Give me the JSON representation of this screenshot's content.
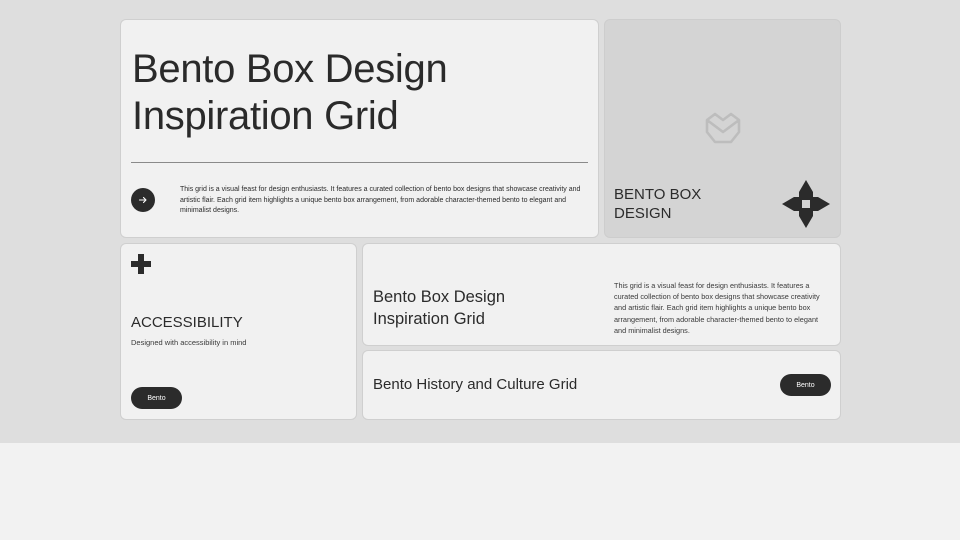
{
  "hero": {
    "title_line1": "Bento Box Design",
    "title_line2": "Inspiration Grid",
    "description": "This grid is a visual feast for design enthusiasts. It features a curated collection of bento box designs that showcase creativity and artistic flair. Each grid item highlights a unique bento box arrangement, from adorable character-themed bento to elegant and minimalist designs.",
    "arrow_icon": "arrow-right-icon"
  },
  "logo_card": {
    "title_line1": "BENTO BOX",
    "title_line2": "DESIGN",
    "logo_icon": "bento-logo-icon",
    "star_icon": "eight-point-star-icon"
  },
  "accessibility": {
    "icon": "plus-icon",
    "title": "ACCESSIBILITY",
    "subtitle": "Designed with accessibility in mind",
    "button_label": "Bento"
  },
  "feature": {
    "title_line1": "Bento Box Design",
    "title_line2": "Inspiration Grid",
    "description": "This grid is a visual feast for design enthusiasts. It features a curated collection of bento box designs that showcase creativity and artistic flair. Each grid item highlights a unique bento box arrangement, from adorable character-themed bento to elegant and minimalist designs."
  },
  "history": {
    "title": "Bento History and Culture Grid",
    "button_label": "Bento"
  },
  "colors": {
    "background": "#dedede",
    "card": "#f1f1f1",
    "logo_card": "#d4d4d4",
    "accent_dark": "#2b2b2b"
  }
}
